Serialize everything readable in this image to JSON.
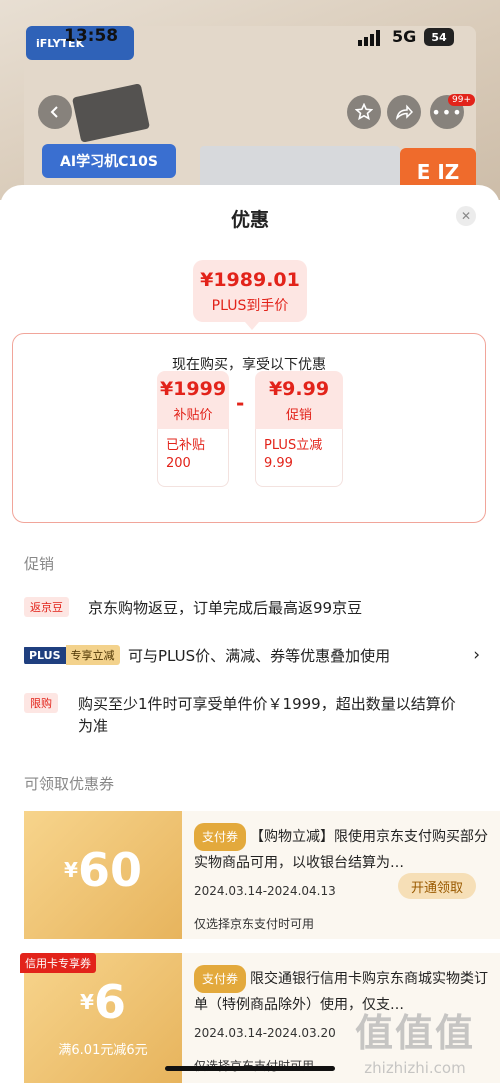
{
  "status": {
    "time": "13:58",
    "network": "5G",
    "battery": "54"
  },
  "background": {
    "brand": "iFLYTEK",
    "product_label": "AI学习机C10S",
    "corner_label": "E IZ",
    "badge": "99+"
  },
  "sheet": {
    "title": "优惠",
    "final_price": "¥1989.01",
    "final_label": "PLUS到手价",
    "box_title": "现在购买，享受以下优惠",
    "minus": "-",
    "items": [
      {
        "price": "¥1999",
        "label": "补贴价",
        "sub": "已补贴 200"
      },
      {
        "price": "¥9.99",
        "label": "促销",
        "sub": "PLUS立减 9.99"
      }
    ]
  },
  "promo": {
    "section": "促销",
    "rows": [
      {
        "tag": "返京豆",
        "text": "京东购物返豆，订单完成后最高返99京豆"
      },
      {
        "tag_a": "PLUS",
        "tag_b": "专享立减",
        "text": "可与PLUS价、满减、券等优惠叠加使用",
        "chevron": "›"
      },
      {
        "tag": "限购",
        "text": "购买至少1件时可享受单件价￥1999，超出数量以结算价为准"
      }
    ]
  },
  "coupons": {
    "section": "可领取优惠券",
    "items": [
      {
        "currency": "¥",
        "amount": "60",
        "tag": "支付券",
        "desc": "【购物立减】限使用京东支付购买部分实物商品可用，以收银台结算为…",
        "date": "2024.03.14-2024.04.13",
        "note": "仅选择京东支付时可用",
        "button": "开通领取"
      },
      {
        "badge": "信用卡专享券",
        "currency": "¥",
        "amount": "6",
        "condition": "满6.01元减6元",
        "tag": "支付券",
        "desc": "限交通银行信用卡购京东商城实物类订单（特例商品除外）使用，仅支…",
        "date": "2024.03.14-2024.03.20",
        "note": "仅选择京东支付时可用"
      }
    ]
  },
  "watermark": {
    "big": "值值值",
    "small": "zhizhizhi.com"
  }
}
